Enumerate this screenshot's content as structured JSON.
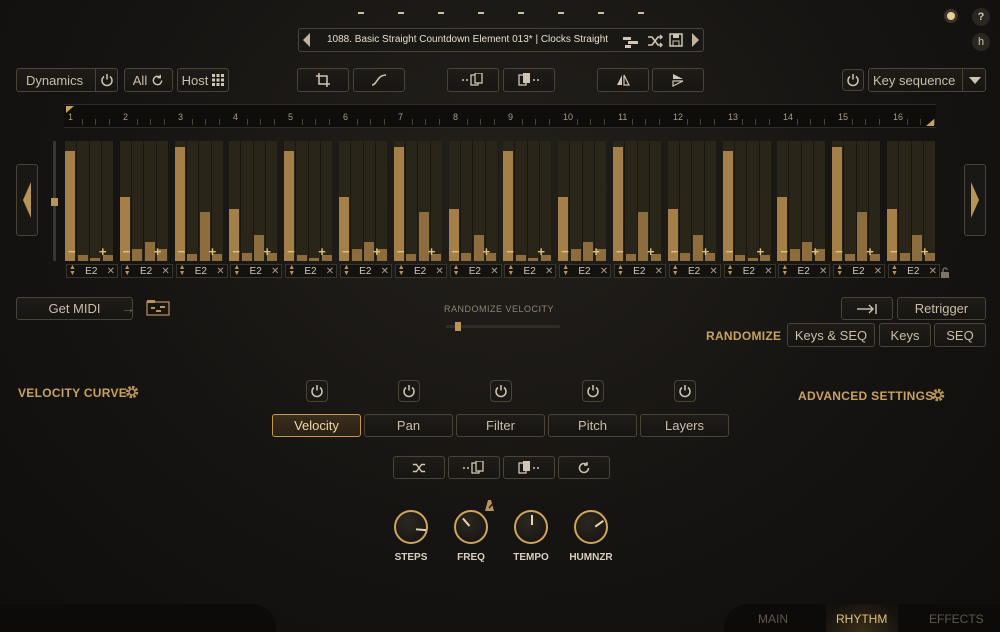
{
  "header": {
    "preset_name": "1088. Basic Straight Countdown Element 013* | Clocks Straight",
    "help_label": "?",
    "h_label": "h"
  },
  "toolbar": {
    "dynamics_label": "Dynamics",
    "all_label": "All",
    "host_label": "Host",
    "key_sequence_label": "Key sequence"
  },
  "ruler": {
    "numbers": [
      "1",
      "2",
      "3",
      "4",
      "5",
      "6",
      "7",
      "8",
      "9",
      "10",
      "11",
      "12",
      "13",
      "14",
      "15",
      "16"
    ]
  },
  "steps": {
    "note": "E2",
    "velocity_bars": [
      [
        0.95,
        0.05,
        0.03,
        0.05
      ],
      [
        0.55,
        0.1,
        0.16,
        0.1
      ],
      [
        0.98,
        0.06,
        0.42,
        0.06
      ],
      [
        0.45,
        0.07,
        0.22,
        0.07
      ],
      [
        0.95,
        0.05,
        0.03,
        0.05
      ],
      [
        0.55,
        0.1,
        0.16,
        0.1
      ],
      [
        0.98,
        0.06,
        0.42,
        0.06
      ],
      [
        0.45,
        0.07,
        0.22,
        0.07
      ],
      [
        0.95,
        0.05,
        0.03,
        0.05
      ],
      [
        0.55,
        0.1,
        0.16,
        0.1
      ],
      [
        0.98,
        0.06,
        0.42,
        0.06
      ],
      [
        0.45,
        0.07,
        0.22,
        0.07
      ],
      [
        0.95,
        0.05,
        0.03,
        0.05
      ],
      [
        0.55,
        0.1,
        0.16,
        0.1
      ],
      [
        0.98,
        0.06,
        0.42,
        0.06
      ],
      [
        0.45,
        0.07,
        0.22,
        0.07
      ]
    ]
  },
  "midi": {
    "get_midi_label": "Get MIDI"
  },
  "randomize_velocity": {
    "label": "RANDOMIZE VELOCITY",
    "value": 0.08
  },
  "right_controls": {
    "retrigger_label": "Retrigger"
  },
  "randomize": {
    "title": "RANDOMIZE",
    "keys_seq_label": "Keys & SEQ",
    "keys_label": "Keys",
    "seq_label": "SEQ"
  },
  "velocity_curve_title": "VELOCITY CURVE",
  "advanced_settings_title": "ADVANCED SETTINGS",
  "tabs": [
    {
      "label": "Velocity",
      "active": true
    },
    {
      "label": "Pan",
      "active": false
    },
    {
      "label": "Filter",
      "active": false
    },
    {
      "label": "Pitch",
      "active": false
    },
    {
      "label": "Layers",
      "active": false
    }
  ],
  "knobs": [
    {
      "label": "STEPS",
      "value": 0.85
    },
    {
      "label": "FREQ",
      "value": 0.35
    },
    {
      "label": "TEMPO",
      "value": 0.5
    },
    {
      "label": "HUMNZR",
      "value": 0.7
    }
  ],
  "bottom_tabs": [
    {
      "label": "MAIN",
      "active": false
    },
    {
      "label": "RHYTHM",
      "active": true
    },
    {
      "label": "EFFECTS",
      "active": false
    }
  ],
  "colors": {
    "accent": "#c9a15a",
    "bar": "#8d6d3e",
    "background": "#161412"
  }
}
